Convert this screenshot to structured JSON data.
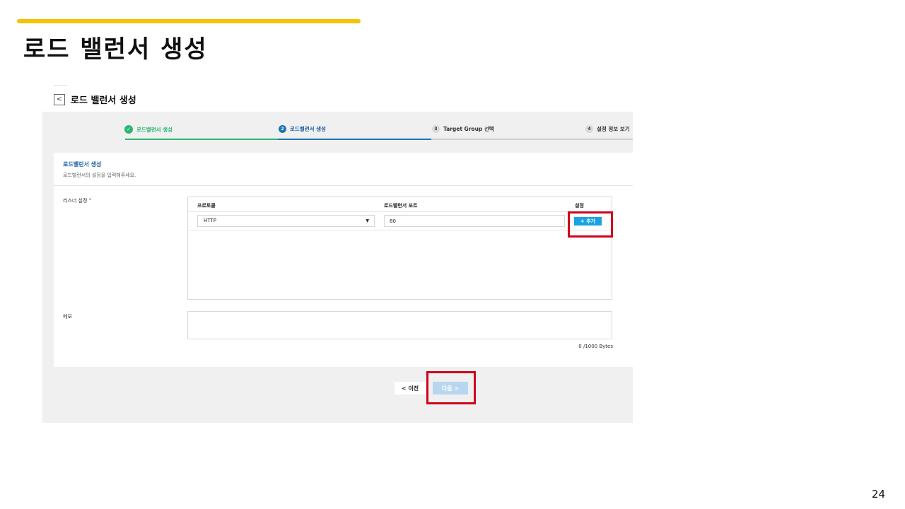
{
  "slide": {
    "title": "로드 밸런서 생성",
    "page_number": "24",
    "accent_color": "#f5c400",
    "highlight_color": "#d0021b"
  },
  "screen": {
    "back_icon": "chevron-left-icon",
    "back_glyph": "<",
    "title": "로드 밸런서 생성",
    "steps": [
      {
        "glyph": "✓",
        "label": "로드밸런서 생성",
        "state": "done"
      },
      {
        "glyph": "2",
        "label": "로드밸런서 생성",
        "state": "active"
      },
      {
        "glyph": "3",
        "label": "Target Group 선택",
        "state": "todo"
      },
      {
        "glyph": "4",
        "label": "설정 정보 보기",
        "state": "todo"
      }
    ],
    "panel": {
      "heading": "로드밸런서 생성",
      "description": "로드밸런서의 설정을 입력해주세요."
    },
    "listener": {
      "label": "리스너 설정",
      "required_mark": "*",
      "columns": [
        "프로토콜",
        "로드밸런서 포트",
        "설정"
      ],
      "protocol_value": "HTTP",
      "caret": "▼",
      "port_value": "80",
      "add_label": "+ 추가"
    },
    "memo": {
      "label": "메모",
      "value": "",
      "byte_count": "0 /1000 Bytes"
    },
    "nav": {
      "prev_label": "<  이전",
      "next_label": "다음  >"
    },
    "colors": {
      "step_done": "#2bb673",
      "step_active": "#1d75b3",
      "add_button": "#1aa3e0",
      "next_button_disabled": "#b9d6f1"
    }
  }
}
